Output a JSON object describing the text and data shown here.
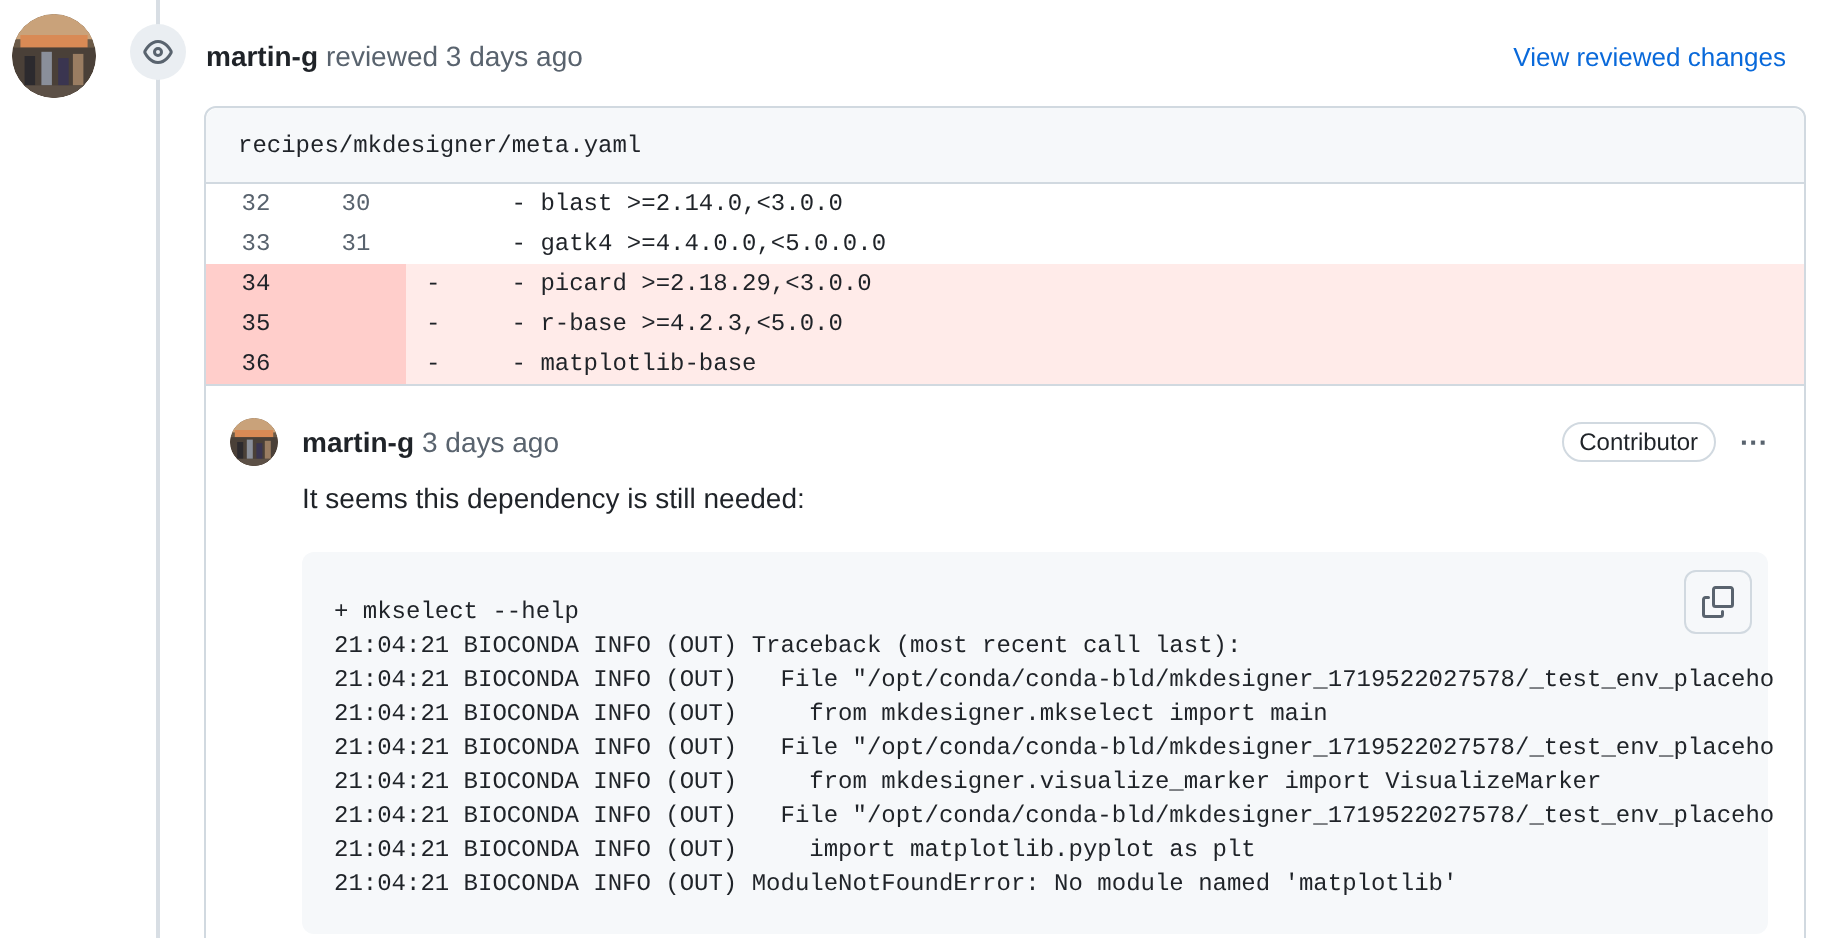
{
  "review": {
    "author": "martin-g",
    "action": "reviewed 3 days ago",
    "link": "View reviewed changes"
  },
  "file": {
    "path": "recipes/mkdesigner/meta.yaml",
    "rows": [
      {
        "kind": "context",
        "old": "32",
        "new": "30",
        "marker": "",
        "code": "    - blast >=2.14.0,<3.0.0"
      },
      {
        "kind": "context",
        "old": "33",
        "new": "31",
        "marker": "",
        "code": "    - gatk4 >=4.4.0.0,<5.0.0.0"
      },
      {
        "kind": "deleted",
        "old": "34",
        "new": "",
        "marker": "-",
        "code": "    - picard >=2.18.29,<3.0.0"
      },
      {
        "kind": "deleted",
        "old": "35",
        "new": "",
        "marker": "-",
        "code": "    - r-base >=4.2.3,<5.0.0"
      },
      {
        "kind": "deleted",
        "old": "36",
        "new": "",
        "marker": "-",
        "code": "    - matplotlib-base"
      }
    ]
  },
  "comment": {
    "author": "martin-g",
    "time": "3 days ago",
    "badge": "Contributor",
    "more": "···",
    "body": "It seems this dependency is still needed:",
    "code_lines": [
      "+ mkselect --help",
      "21:04:21 BIOCONDA INFO (OUT) Traceback (most recent call last):",
      "21:04:21 BIOCONDA INFO (OUT)   File \"/opt/conda/conda-bld/mkdesigner_1719522027578/_test_env_placeho",
      "21:04:21 BIOCONDA INFO (OUT)     from mkdesigner.mkselect import main",
      "21:04:21 BIOCONDA INFO (OUT)   File \"/opt/conda/conda-bld/mkdesigner_1719522027578/_test_env_placeho",
      "21:04:21 BIOCONDA INFO (OUT)     from mkdesigner.visualize_marker import VisualizeMarker",
      "21:04:21 BIOCONDA INFO (OUT)   File \"/opt/conda/conda-bld/mkdesigner_1719522027578/_test_env_placeho",
      "21:04:21 BIOCONDA INFO (OUT)     import matplotlib.pyplot as plt",
      "21:04:21 BIOCONDA INFO (OUT) ModuleNotFoundError: No module named 'matplotlib'"
    ]
  }
}
